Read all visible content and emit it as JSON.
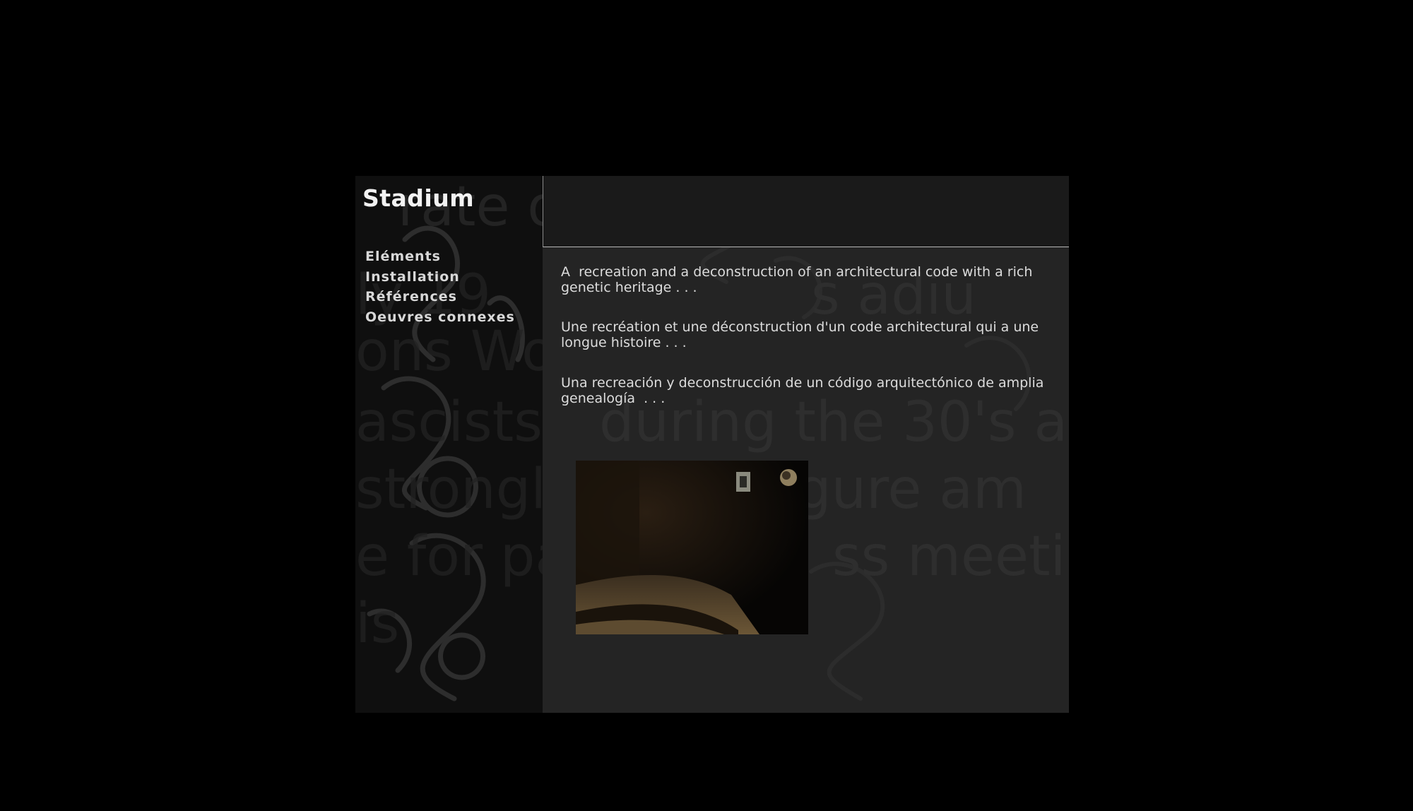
{
  "site": {
    "title": "Stadium"
  },
  "nav": {
    "items": [
      {
        "label": "Eléments"
      },
      {
        "label": "Installation"
      },
      {
        "label": "Références"
      },
      {
        "label": "Oeuvres connexes"
      }
    ]
  },
  "content": {
    "paragraphs": [
      {
        "lang": "en",
        "text": "A  recreation and a deconstruction of an architectural code with a rich\ngenetic heritage . . ."
      },
      {
        "lang": "fr",
        "text": "Une recréation et une déconstruction d'un code architectural qui a une\nlongue histoire . . ."
      },
      {
        "lang": "es",
        "text": "Una recreación y deconstrucción de un código arquitectónico de amplia\ngenealogía  . . ."
      }
    ]
  },
  "background_texture": {
    "icon": "handwritten-script-texture"
  },
  "colors": {
    "page_background": "#000000",
    "sidebar_background": "#0f0f0f",
    "content_background": "#242424",
    "text": "#dcdcdc",
    "title": "#f2f2f2"
  }
}
